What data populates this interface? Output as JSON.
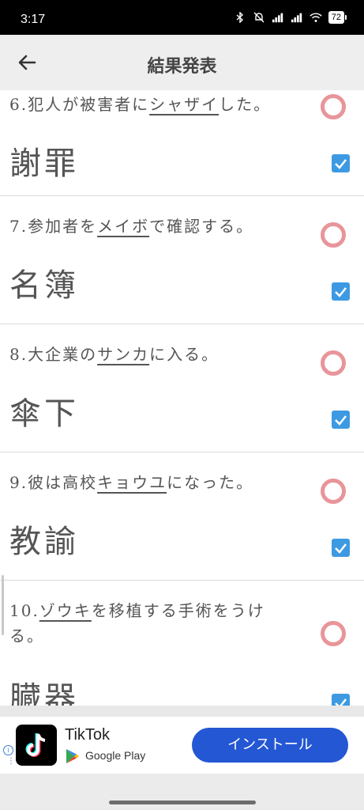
{
  "status_bar": {
    "time": "3:17",
    "battery": "72",
    "icons": [
      "bluetooth-icon",
      "mute-icon",
      "signal-icon",
      "signal-icon",
      "wifi-icon",
      "battery-icon"
    ]
  },
  "app_bar": {
    "title": "結果発表",
    "back_icon": "back-arrow-icon"
  },
  "questions": [
    {
      "prefix": "6.犯人が被害者に",
      "katakana": "シャザイ",
      "suffix": "した。",
      "answer": "謝罪",
      "correct": true
    },
    {
      "prefix": "7.参加者を",
      "katakana": "メイボ",
      "suffix": "で確認する。",
      "answer": "名簿",
      "correct": true
    },
    {
      "prefix": "8.大企業の",
      "katakana": "サンカ",
      "suffix": "に入る。",
      "answer": "傘下",
      "correct": true
    },
    {
      "prefix": "9.彼は高校",
      "katakana": "キョウユ",
      "suffix": "になった。",
      "answer": "教諭",
      "correct": true
    },
    {
      "prefix": "10.",
      "katakana": "ゾウキ",
      "suffix": "を移植する手術をうける。",
      "answer": "臓器",
      "correct": true
    }
  ],
  "ad": {
    "app_name": "TikTok",
    "store": "Google Play",
    "install_label": "インストール",
    "info_label": "i"
  },
  "colors": {
    "accent": "#2457d4",
    "checkbox": "#3d9ae2",
    "circle": "#e8959a"
  }
}
